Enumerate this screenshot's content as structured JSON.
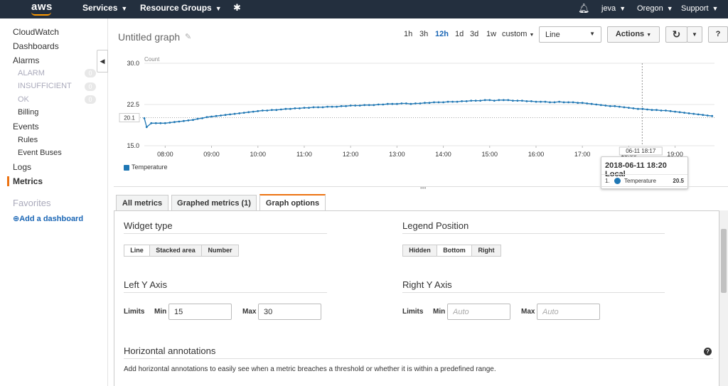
{
  "topnav": {
    "logo": "aws",
    "services": "Services",
    "resource_groups": "Resource Groups",
    "pin_icon": "pin-icon",
    "bell_icon": "bell-icon",
    "user": "jeva",
    "region": "Oregon",
    "support": "Support"
  },
  "sidebar": {
    "cloudwatch": "CloudWatch",
    "dashboards": "Dashboards",
    "alarms": "Alarms",
    "alarm": "ALARM",
    "alarm_count": "0",
    "insufficient": "INSUFFICIENT",
    "insufficient_count": "0",
    "ok": "OK",
    "ok_count": "0",
    "billing": "Billing",
    "events": "Events",
    "rules": "Rules",
    "event_buses": "Event Buses",
    "logs": "Logs",
    "metrics": "Metrics",
    "favorites": "Favorites",
    "add_dashboard": "Add a dashboard"
  },
  "graph": {
    "title": "Untitled graph",
    "ranges": [
      "1h",
      "3h",
      "12h",
      "1d",
      "3d",
      "1w"
    ],
    "selected_range": "12h",
    "custom": "custom",
    "view_type": "Line",
    "actions": "Actions",
    "refresh_icon": "refresh-icon",
    "help_icon": "help-icon"
  },
  "chart_data": {
    "type": "line",
    "ylabel": "Count",
    "yticks": [
      15.0,
      22.5,
      30.0
    ],
    "ylim": [
      15,
      30
    ],
    "xticks": [
      "08:00",
      "09:00",
      "10:00",
      "11:00",
      "12:00",
      "13:00",
      "14:00",
      "15:00",
      "16:00",
      "17:00",
      "18:00",
      "19:00"
    ],
    "x_start_hours": 7.55,
    "x_end_hours": 19.85,
    "series": [
      {
        "name": "Temperature",
        "color": "#1f77b4",
        "x": [
          7.55,
          7.6,
          7.7,
          7.8,
          7.9,
          8.0,
          8.1,
          8.2,
          8.3,
          8.4,
          8.5,
          8.6,
          8.7,
          8.8,
          8.9,
          9.0,
          9.1,
          9.2,
          9.3,
          9.4,
          9.5,
          9.6,
          9.7,
          9.8,
          9.9,
          10.0,
          10.1,
          10.2,
          10.3,
          10.4,
          10.5,
          10.6,
          10.7,
          10.8,
          10.9,
          11.0,
          11.1,
          11.2,
          11.3,
          11.4,
          11.5,
          11.6,
          11.7,
          11.8,
          11.9,
          12.0,
          12.1,
          12.2,
          12.3,
          12.4,
          12.5,
          12.6,
          12.7,
          12.8,
          12.9,
          13.0,
          13.1,
          13.2,
          13.3,
          13.4,
          13.5,
          13.6,
          13.7,
          13.8,
          13.9,
          14.0,
          14.1,
          14.2,
          14.3,
          14.4,
          14.5,
          14.6,
          14.7,
          14.8,
          14.9,
          15.0,
          15.1,
          15.2,
          15.3,
          15.4,
          15.5,
          15.6,
          15.7,
          15.8,
          15.9,
          16.0,
          16.1,
          16.2,
          16.3,
          16.4,
          16.5,
          16.6,
          16.7,
          16.8,
          16.9,
          17.0,
          17.1,
          17.2,
          17.3,
          17.4,
          17.5,
          17.6,
          17.7,
          17.8,
          17.9,
          18.0,
          18.1,
          18.2,
          18.3,
          18.4,
          18.5,
          18.6,
          18.7,
          18.8,
          18.9,
          19.0,
          19.1,
          19.2,
          19.3,
          19.4,
          19.5,
          19.6,
          19.7,
          19.8
        ],
        "values": [
          20.0,
          18.4,
          19.1,
          19.1,
          19.1,
          19.1,
          19.2,
          19.3,
          19.4,
          19.5,
          19.6,
          19.7,
          19.9,
          20.0,
          20.2,
          20.3,
          20.4,
          20.5,
          20.6,
          20.7,
          20.8,
          20.9,
          21.0,
          21.1,
          21.2,
          21.3,
          21.4,
          21.4,
          21.5,
          21.5,
          21.6,
          21.7,
          21.7,
          21.8,
          21.8,
          21.9,
          21.9,
          22.0,
          22.0,
          22.0,
          22.1,
          22.1,
          22.1,
          22.2,
          22.2,
          22.3,
          22.3,
          22.3,
          22.4,
          22.4,
          22.4,
          22.5,
          22.5,
          22.6,
          22.6,
          22.6,
          22.7,
          22.7,
          22.6,
          22.7,
          22.7,
          22.8,
          22.8,
          22.9,
          22.9,
          22.9,
          23.0,
          23.0,
          23.0,
          23.1,
          23.1,
          23.2,
          23.2,
          23.2,
          23.3,
          23.3,
          23.2,
          23.3,
          23.3,
          23.3,
          23.2,
          23.2,
          23.2,
          23.1,
          23.1,
          23.0,
          23.0,
          23.0,
          22.9,
          22.9,
          23.0,
          22.9,
          22.9,
          22.9,
          22.8,
          22.8,
          22.7,
          22.6,
          22.5,
          22.4,
          22.3,
          22.2,
          22.2,
          22.1,
          22.0,
          21.9,
          21.8,
          21.7,
          21.7,
          21.6,
          21.5,
          21.5,
          21.4,
          21.4,
          21.3,
          21.2,
          21.1,
          21.0,
          20.9,
          20.8,
          20.7,
          20.6,
          20.5,
          20.4
        ]
      }
    ],
    "reference_line": 20.1,
    "reference_label": "20.1",
    "crosshair_label": "06-11 18:17",
    "crosshair_x_hours": 18.29,
    "grid": true,
    "legend": "bottom-left"
  },
  "tooltip": {
    "time": "2018-06-11 18:20 Local",
    "index": "1.",
    "series": "Temperature",
    "value": "20.5"
  },
  "tabs": {
    "all_metrics": "All metrics",
    "graphed_metrics": "Graphed metrics (1)",
    "graph_options": "Graph options"
  },
  "options": {
    "widget_type": "Widget type",
    "widget_options": [
      "Line",
      "Stacked area",
      "Number"
    ],
    "widget_selected": "Line",
    "legend_position": "Legend Position",
    "legend_options": [
      "Hidden",
      "Bottom",
      "Right"
    ],
    "legend_selected": "Bottom",
    "left_y": "Left Y Axis",
    "right_y": "Right Y Axis",
    "limits": "Limits",
    "min": "Min",
    "max": "Max",
    "left_min": "15",
    "left_max": "30",
    "right_min_placeholder": "Auto",
    "right_max_placeholder": "Auto",
    "horizontal_annotations": "Horizontal annotations",
    "annotations_desc": "Add horizontal annotations to easily see when a metric breaches a threshold or whether it is within a predefined range."
  }
}
